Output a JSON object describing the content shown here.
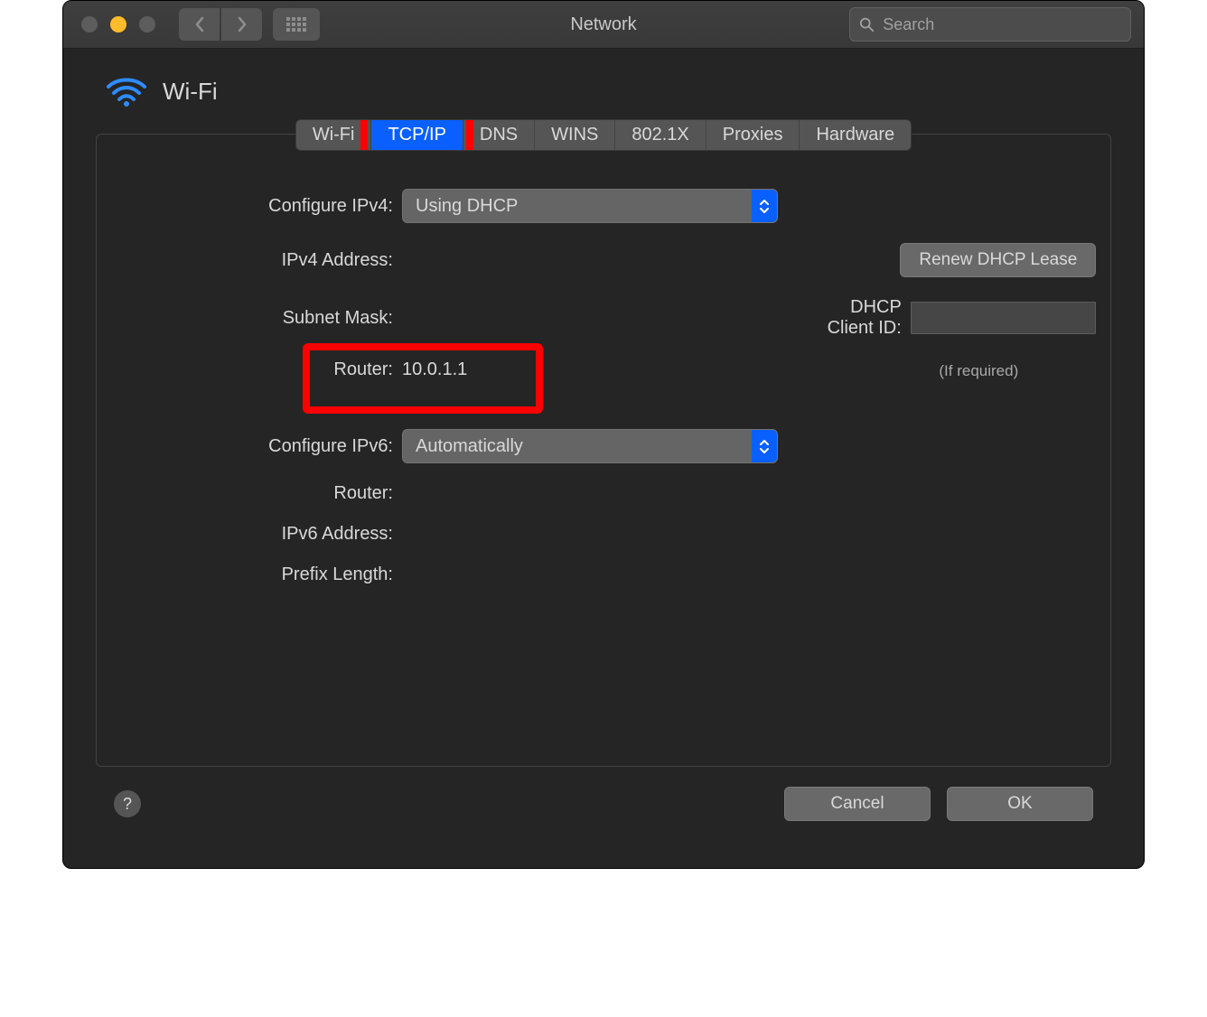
{
  "window": {
    "title": "Network"
  },
  "search": {
    "placeholder": "Search"
  },
  "header": {
    "title": "Wi-Fi"
  },
  "tabs": [
    {
      "label": "Wi-Fi",
      "active": false
    },
    {
      "label": "TCP/IP",
      "active": true
    },
    {
      "label": "DNS",
      "active": false
    },
    {
      "label": "WINS",
      "active": false
    },
    {
      "label": "802.1X",
      "active": false
    },
    {
      "label": "Proxies",
      "active": false
    },
    {
      "label": "Hardware",
      "active": false
    }
  ],
  "form": {
    "configure_ipv4_label": "Configure IPv4:",
    "configure_ipv4_value": "Using DHCP",
    "ipv4_address_label": "IPv4 Address:",
    "ipv4_address_value": "",
    "subnet_mask_label": "Subnet Mask:",
    "subnet_mask_value": "",
    "router4_label": "Router:",
    "router4_value": "10.0.1.1",
    "configure_ipv6_label": "Configure IPv6:",
    "configure_ipv6_value": "Automatically",
    "router6_label": "Router:",
    "router6_value": "",
    "ipv6_address_label": "IPv6 Address:",
    "ipv6_address_value": "",
    "prefix_length_label": "Prefix Length:",
    "prefix_length_value": ""
  },
  "side": {
    "renew_btn": "Renew DHCP Lease",
    "dhcp_client_id_label": "DHCP Client ID:",
    "dhcp_client_id_hint": "(If required)"
  },
  "footer": {
    "cancel": "Cancel",
    "ok": "OK"
  }
}
